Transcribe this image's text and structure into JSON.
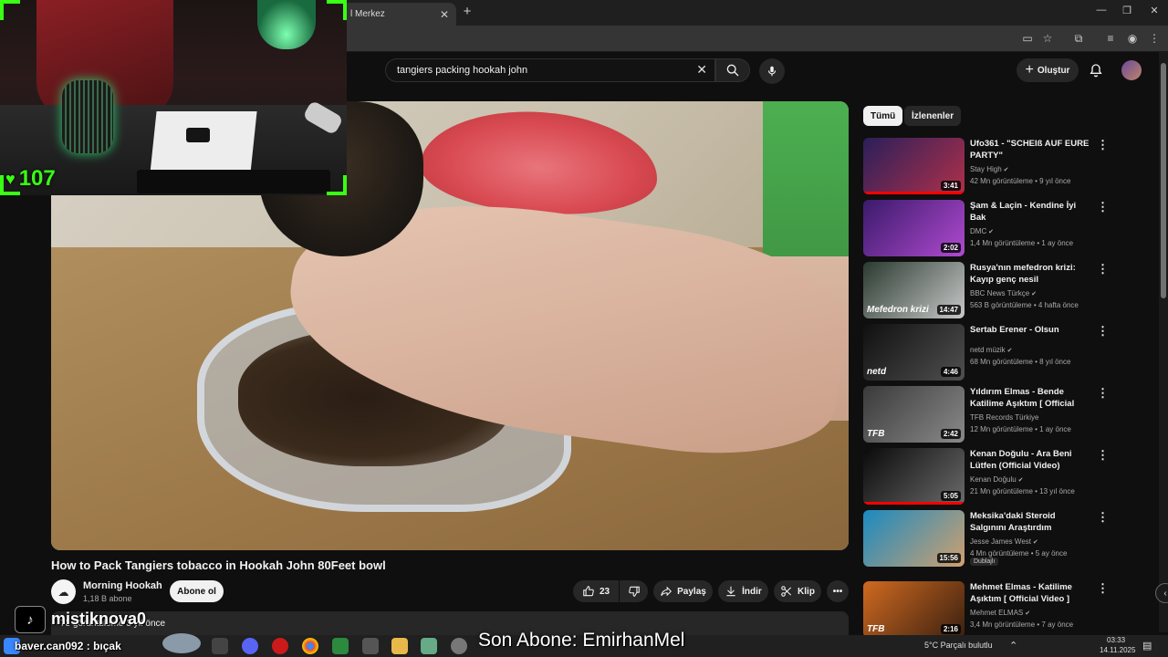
{
  "browser": {
    "tab_title": "l Merkez",
    "new_tab_label": "+",
    "window_controls": [
      "—",
      "❐",
      "✕"
    ]
  },
  "masthead": {
    "search_query": "tangiers packing hookah john",
    "create_label": "Oluştur",
    "icons": [
      "clear-icon",
      "search-icon",
      "mic-icon",
      "bell-icon"
    ]
  },
  "video": {
    "title": "How to Pack Tangiers tobacco in Hookah John 80Feet bowl",
    "channel": "Morning Hookah",
    "subscribers": "1,18 B abone",
    "subscribe_label": "Abone ol",
    "likes": "23",
    "share_label": "Paylaş",
    "download_label": "İndir",
    "clip_label": "Klip",
    "description_views": "73 görüntüleme  3 yıl önce"
  },
  "chips": [
    "Tümü",
    "İzlenenler"
  ],
  "recommendations": [
    {
      "title": "Ufo361 - \"SCHEIß AUF EURE PARTY\"",
      "channel": "Stay High",
      "verified": true,
      "meta": "42 Mn görüntüleme • 9 yıl önce",
      "duration": "3:41",
      "thumb_colors": [
        "#2a1f5a",
        "#b0304a"
      ],
      "progress": 1.0
    },
    {
      "title": "Şam & Laçin - Kendine İyi Bak",
      "channel": "DMC",
      "verified": true,
      "meta": "1,4 Mn görüntüleme • 1 ay önce",
      "duration": "2:02",
      "thumb_colors": [
        "#3a1a6a",
        "#b04ad0"
      ],
      "progress": 0.0
    },
    {
      "title": "Rusya'nın mefedron krizi: Kayıp genç nesil",
      "channel": "BBC News Türkçe",
      "verified": true,
      "meta": "563 B görüntüleme • 4 hafta önce",
      "duration": "14:47",
      "thumb_colors": [
        "#2a3a30",
        "#c8c8c8"
      ],
      "thumb_caption": "Mefedron krizi",
      "progress": 0.0
    },
    {
      "title": "Sertab Erener - Olsun",
      "channel": "netd müzik",
      "verified": true,
      "meta": "68 Mn görüntüleme • 8 yıl önce",
      "duration": "4:46",
      "thumb_colors": [
        "#101010",
        "#505050"
      ],
      "thumb_caption": "netd",
      "progress": 0.0
    },
    {
      "title": "Yıldırım Elmas - Bende Katilime Aşıktım  [ Official Video ]",
      "channel": "TFB Records Türkiye",
      "verified": false,
      "meta": "12 Mn görüntüleme • 1 ay önce",
      "duration": "2:42",
      "thumb_colors": [
        "#3a3a3a",
        "#8a8a8a"
      ],
      "thumb_caption": "TFB",
      "progress": 0.0
    },
    {
      "title": "Kenan Doğulu - Ara Beni Lütfen (Official Video) #Festival",
      "channel": "Kenan Doğulu",
      "verified": true,
      "meta": "21 Mn görüntüleme • 13 yıl önce",
      "duration": "5:05",
      "thumb_colors": [
        "#0a0a0a",
        "#6a6a6a"
      ],
      "progress": 1.0
    },
    {
      "title": "Meksika'daki Steroid Salgınını Araştırdım",
      "channel": "Jesse James West",
      "verified": true,
      "meta": "4 Mn görüntüleme • 5 ay önce",
      "duration": "15:56",
      "thumb_colors": [
        "#1a8ac0",
        "#d0a070"
      ],
      "badge": "Dublajlı",
      "progress": 0.0
    },
    {
      "title": "Mehmet Elmas - Katilime Aşıktım [ Official Video ]",
      "channel": "Mehmet ELMAS",
      "verified": true,
      "meta": "3,4 Mn görüntüleme • 7 ay önce",
      "duration": "2:16",
      "thumb_colors": [
        "#d06a20",
        "#3a2010"
      ],
      "thumb_caption": "TFB",
      "progress": 0.0
    }
  ],
  "stream_overlay": {
    "counter": "107",
    "tiktok_name": "mistiknova0",
    "chat_user": "baver.can092",
    "chat_text": "bıçak",
    "last_sub": "Son Abone: EmirhanMel"
  },
  "taskbar": {
    "weather": "5°C  Parçalı bulutlu",
    "time": "03:33",
    "date": "14.11.2025"
  },
  "colors": {
    "background": "#0f0f0f",
    "accent_green": "#39ff14",
    "progress_red": "#ff0000"
  }
}
